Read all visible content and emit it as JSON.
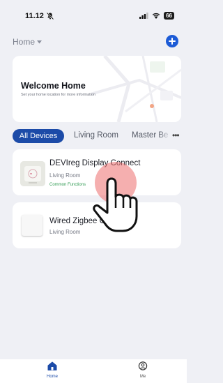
{
  "status_bar": {
    "time": "11.12",
    "battery": "66"
  },
  "header": {
    "home_selector": "Home",
    "add_icon": "plus-circle-icon"
  },
  "welcome": {
    "title": "Welcome Home",
    "subtitle": "Set your home location for more information"
  },
  "tabs": [
    "All Devices",
    "Living Room",
    "Master Be"
  ],
  "devices": [
    {
      "name": "DEVIreg Display Connect",
      "room": "Living Room",
      "functions": "Common Functions"
    },
    {
      "name": "Wired Zigbee Ga",
      "room": "Living Room"
    }
  ],
  "tab_bar": {
    "home": "Home",
    "me": "Me"
  },
  "colors": {
    "accent": "#1c4ba8",
    "add_button": "#1c5bd6",
    "background": "#eff0f5",
    "functions_text": "#2f9a52"
  }
}
